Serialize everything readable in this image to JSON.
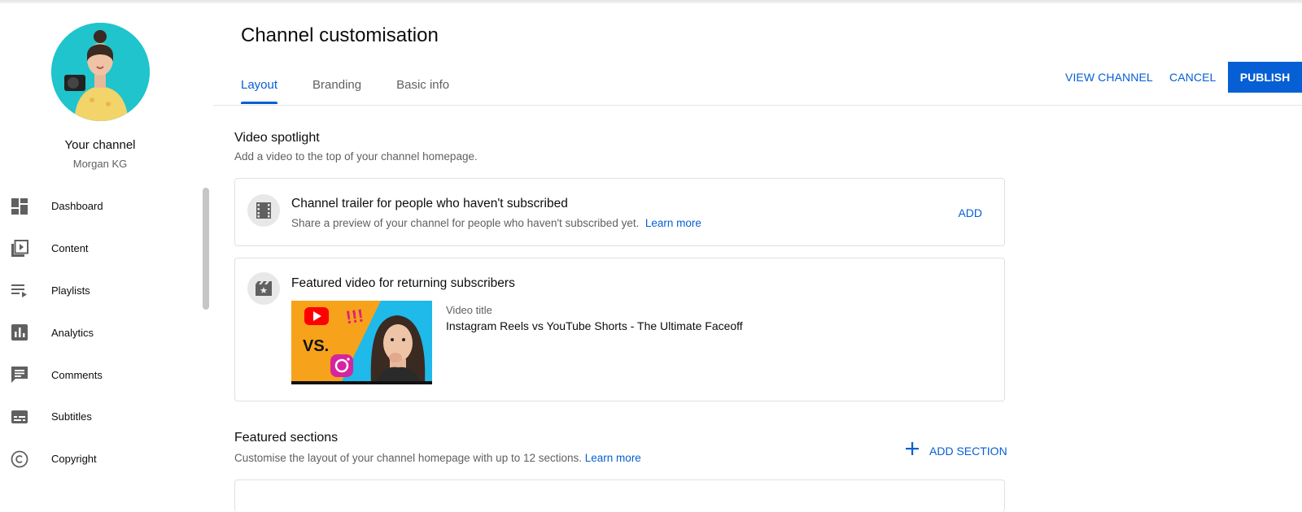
{
  "sidebar": {
    "channel_name": "Your channel",
    "channel_handle": "Morgan KG",
    "items": [
      {
        "label": "Dashboard",
        "icon": "dashboard-icon"
      },
      {
        "label": "Content",
        "icon": "content-icon"
      },
      {
        "label": "Playlists",
        "icon": "playlists-icon"
      },
      {
        "label": "Analytics",
        "icon": "analytics-icon"
      },
      {
        "label": "Comments",
        "icon": "comments-icon"
      },
      {
        "label": "Subtitles",
        "icon": "subtitles-icon"
      },
      {
        "label": "Copyright",
        "icon": "copyright-icon"
      }
    ]
  },
  "header": {
    "title": "Channel customisation",
    "tabs": [
      {
        "label": "Layout",
        "active": true
      },
      {
        "label": "Branding",
        "active": false
      },
      {
        "label": "Basic info",
        "active": false
      }
    ],
    "view_channel": "VIEW CHANNEL",
    "cancel": "CANCEL",
    "publish": "PUBLISH"
  },
  "spotlight": {
    "title": "Video spotlight",
    "subtitle": "Add a video to the top of your channel homepage.",
    "trailer": {
      "title": "Channel trailer for people who haven't subscribed",
      "subtitle": "Share a preview of your channel for people who haven't subscribed yet.",
      "learn_more": "Learn more",
      "add": "ADD"
    },
    "featured": {
      "title": "Featured video for returning subscribers",
      "video_label": "Video title",
      "video_title": "Instagram Reels vs YouTube Shorts - The Ultimate Faceoff",
      "thumbnail_text": "VS.",
      "thumbnail_exclaim": "!!!"
    }
  },
  "featured_sections": {
    "title": "Featured sections",
    "subtitle": "Customise the layout of your channel homepage with up to 12 sections.",
    "learn_more": "Learn more",
    "add_section": "ADD SECTION"
  },
  "colors": {
    "accent": "#065fd4",
    "avatar_bg": "#1fc4cc",
    "text_secondary": "#606060"
  }
}
